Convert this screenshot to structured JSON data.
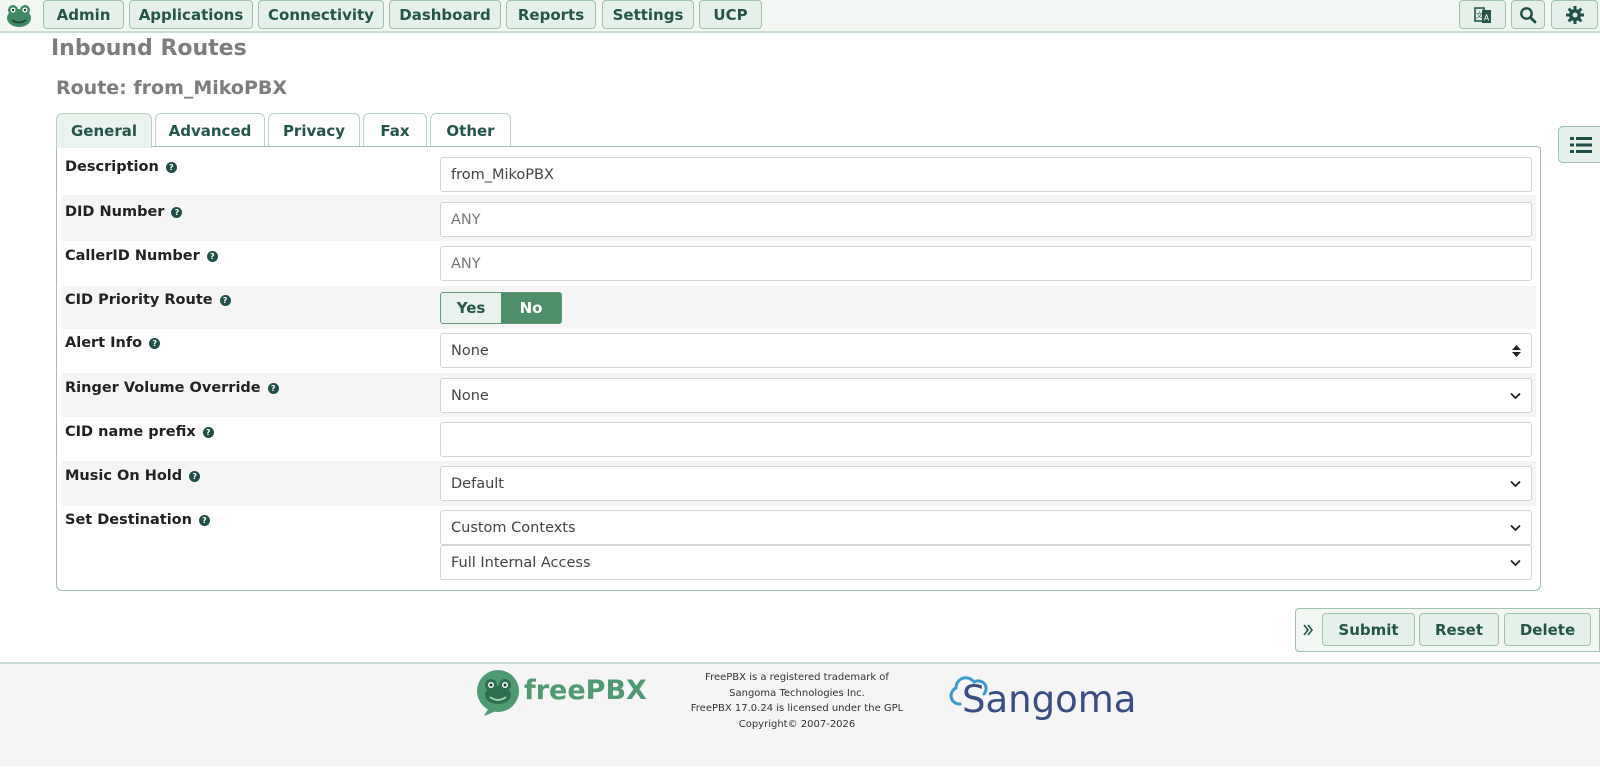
{
  "nav": {
    "items": [
      "Admin",
      "Applications",
      "Connectivity",
      "Dashboard",
      "Reports",
      "Settings",
      "UCP"
    ]
  },
  "icons": {
    "logo": "freepbx-frog-icon",
    "language": "language-icon",
    "search": "search-icon",
    "settings": "gear-icon",
    "list": "list-icon",
    "expand": "double-chevron-right-icon"
  },
  "page": {
    "title": "Inbound Routes",
    "route_title": "Route: from_MikoPBX"
  },
  "tabs": [
    "General",
    "Advanced",
    "Privacy",
    "Fax",
    "Other"
  ],
  "form": {
    "description": {
      "label": "Description",
      "value": "from_MikoPBX"
    },
    "did_number": {
      "label": "DID Number",
      "placeholder": "ANY"
    },
    "callerid_number": {
      "label": "CallerID Number",
      "placeholder": "ANY"
    },
    "cid_priority_route": {
      "label": "CID Priority Route",
      "yes": "Yes",
      "no": "No",
      "selected": "No"
    },
    "alert_info": {
      "label": "Alert Info",
      "value": "None"
    },
    "ringer_volume_override": {
      "label": "Ringer Volume Override",
      "value": "None"
    },
    "cid_name_prefix": {
      "label": "CID name prefix",
      "value": ""
    },
    "music_on_hold": {
      "label": "Music On Hold",
      "value": "Default"
    },
    "set_destination": {
      "label": "Set Destination",
      "category": "Custom Contexts",
      "target": "Full Internal Access"
    }
  },
  "actions": {
    "submit": "Submit",
    "reset": "Reset",
    "delete": "Delete"
  },
  "footer": {
    "freepbx_brand": "freePBX",
    "sangoma_brand": "Sangoma",
    "lines": [
      "FreePBX is a registered trademark of",
      "Sangoma Technologies Inc.",
      "FreePBX 17.0.24 is licensed under the GPL",
      "Copyright© 2007-2026"
    ]
  },
  "colors": {
    "accent": "#4e8f6a",
    "nav_text": "#24554a",
    "border": "#9fc2ad",
    "sangoma": "#3a4d82"
  }
}
